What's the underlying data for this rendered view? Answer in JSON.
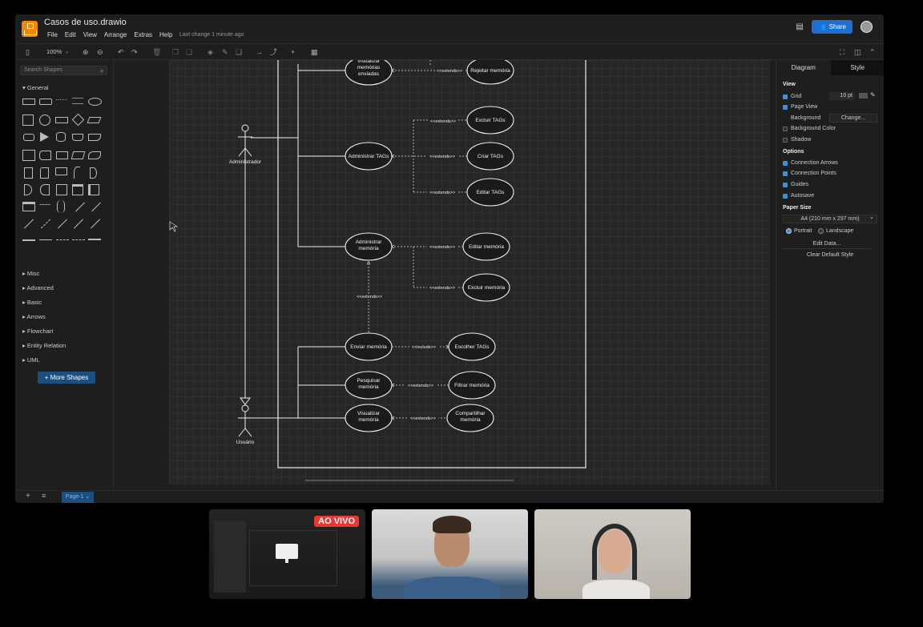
{
  "app": {
    "file_name": "Casos de uso.drawio",
    "menus": [
      "File",
      "Edit",
      "View",
      "Arrange",
      "Extras",
      "Help"
    ],
    "last_change": "Last change 1 minute ago",
    "share_label": "Share"
  },
  "toolbar": {
    "zoom": "100%"
  },
  "left_panel": {
    "search_placeholder": "Search Shapes",
    "general_label": "General",
    "sections": [
      "Misc",
      "Advanced",
      "Basic",
      "Arrows",
      "Flowchart",
      "Entity Relation",
      "UML"
    ],
    "more_shapes_label": "+ More Shapes"
  },
  "diagram": {
    "actors": [
      "Administrador",
      "Usuário"
    ],
    "use_cases": {
      "visualizar_enviadas": "Visualizar memórias enviadas",
      "rejeitar": "Rejeitar memória",
      "administrar_tags": "Administrar TAGs",
      "excluir_tags": "Excluir TAGs",
      "criar_tags": "Criar TAGs",
      "editar_tags": "Editar TAGs",
      "administrar_memoria": "Administrar memória",
      "editar_memoria": "Editar memória",
      "excluir_memoria": "Excluir memória",
      "enviar_memoria": "Enviar memória",
      "escolher_tags": "Escolher TAGs",
      "pesquisar_memoria": "Pesquisar memória",
      "filtrar_memoria": "Filtrar memória",
      "visualizar_memoria": "Visualizar memória",
      "compartilhar_memoria": "Compartilhar memória"
    },
    "extend_label": "<<extends>>",
    "include_label": "<<include>>"
  },
  "right_panel": {
    "tabs": [
      "Diagram",
      "Style"
    ],
    "view_heading": "View",
    "grid_label": "Grid",
    "grid_value": "10 pt",
    "page_view_label": "Page View",
    "background_label": "Background",
    "change_label": "Change...",
    "background_color_label": "Background Color",
    "shadow_label": "Shadow",
    "options_heading": "Options",
    "options": [
      "Connection Arrows",
      "Connection Points",
      "Guides",
      "Autosave"
    ],
    "paper_size_heading": "Paper Size",
    "paper_size_value": "A4 (210 mm x 297 mm)",
    "portrait_label": "Portrait",
    "landscape_label": "Landscape",
    "edit_data_label": "Edit Data...",
    "clear_style_label": "Clear Default Style"
  },
  "bottom": {
    "page_tab": "Page-1"
  },
  "call": {
    "live_badge": "AO VIVO"
  }
}
